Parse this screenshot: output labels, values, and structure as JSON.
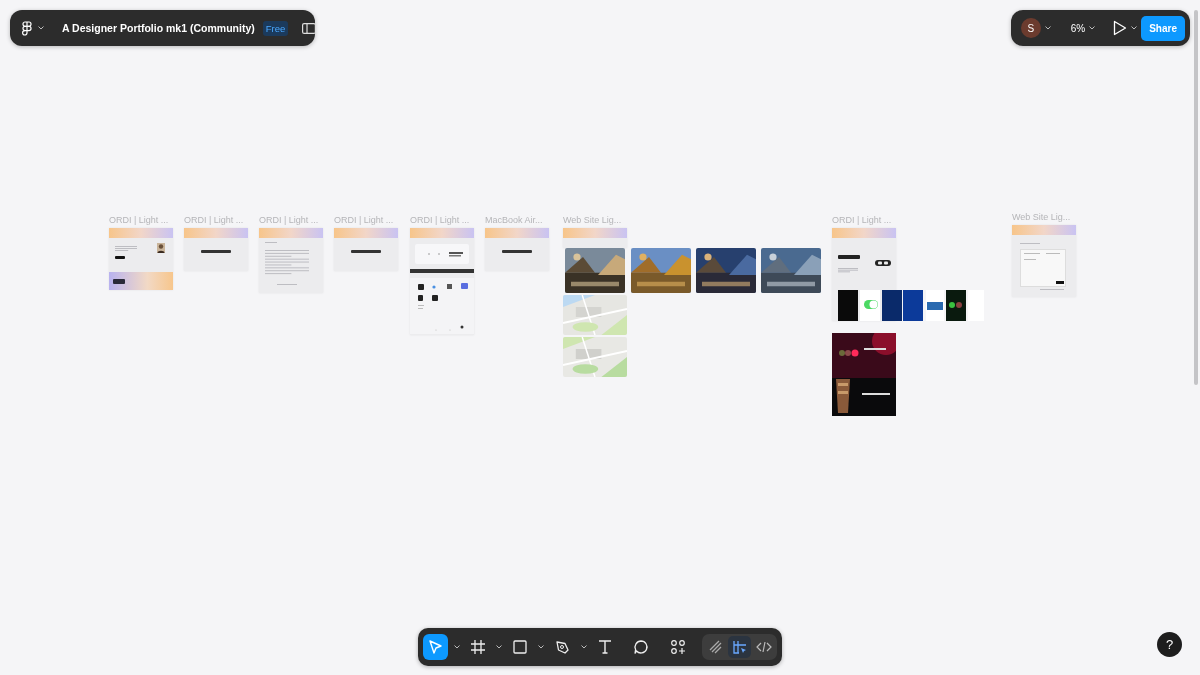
{
  "file": {
    "title": "A Designer Portfolio mk1 (Community)",
    "badge": "Free"
  },
  "header_right": {
    "avatar": "S",
    "zoom": "6%",
    "share": "Share"
  },
  "frames": [
    {
      "label": "ORDI | Light ...",
      "kind": "hero"
    },
    {
      "label": "ORDI | Light ...",
      "kind": "title"
    },
    {
      "label": "ORDI | Light ...",
      "kind": "text"
    },
    {
      "label": "ORDI | Light ...",
      "kind": "title"
    },
    {
      "label": "ORDI | Light ...",
      "kind": "projects"
    },
    {
      "label": "MacBook Air...",
      "kind": "title"
    },
    {
      "label": "Web Site Lig...",
      "kind": "gallery"
    },
    {
      "label": "ORDI | Light ...",
      "kind": "showcase"
    },
    {
      "label": "Web Site Lig...",
      "kind": "contact"
    }
  ],
  "toolbar": {
    "tools": [
      {
        "kind": "move",
        "selected": true,
        "menu": true
      },
      {
        "kind": "frame",
        "selected": false,
        "menu": true
      },
      {
        "kind": "rectangle",
        "selected": false,
        "menu": true
      },
      {
        "kind": "pen",
        "selected": false,
        "menu": true
      },
      {
        "kind": "text",
        "selected": false,
        "menu": false
      },
      {
        "kind": "comment",
        "selected": false,
        "menu": false
      },
      {
        "kind": "actions",
        "selected": false,
        "menu": false
      }
    ],
    "modes": [
      {
        "kind": "draw",
        "selected": false
      },
      {
        "kind": "design",
        "selected": true
      },
      {
        "kind": "dev",
        "selected": false
      }
    ]
  },
  "help": "?"
}
